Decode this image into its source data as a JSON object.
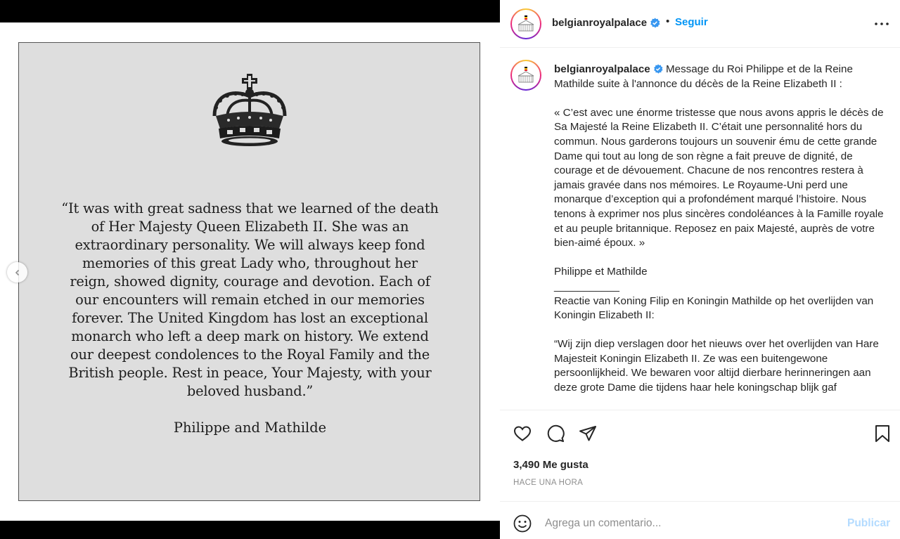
{
  "post": {
    "image": {
      "quote": "“It was with great sadness that we learned of the death of Her Majesty Queen Elizabeth II. She was an extraordinary personality. We will always keep fond memories of this great Lady who, throughout her reign, showed dignity, courage and devotion. Each of our encounters will remain etched in our memories forever. The United Kingdom has lost an exceptional monarch who left a deep mark on history. We extend our deepest condolences to the Royal Family and the British people. Rest in peace, Your Majesty, with your beloved husband.”",
      "signature": "Philippe and Mathilde",
      "background": "#dedede",
      "emblem_icon": "crown-icon"
    },
    "carousel_prev_icon": "chevron-left-icon"
  },
  "header": {
    "username": "belgianroyalpalace",
    "verified": true,
    "separator": "•",
    "follow_label": "Seguir",
    "more_icon": "more-options-icon"
  },
  "caption": {
    "username": "belgianroyalpalace",
    "text": " Message du Roi Philippe et de la Reine Mathilde suite à l'annonce du décès de la Reine Elizabeth II :\n\n« C’est avec une énorme tristesse que nous avons appris le décès de Sa Majesté la Reine Elizabeth II. C’était une personnalité hors du commun. Nous garderons toujours un souvenir ému de cette grande Dame qui tout au long de son règne a fait preuve de dignité, de courage et de dévouement. Chacune de nos rencontres restera à jamais gravée dans nos mémoires. Le Royaume-Uni perd une monarque d’exception qui a profondément marqué l’histoire. Nous tenons à exprimer nos plus sincères condoléances à la Famille royale et au peuple britannique. Reposez en paix Majesté, auprès de votre bien-aimé époux. »\n\nPhilippe et Mathilde\n___________\nReactie van Koning Filip en Koningin Mathilde op het overlijden van Koningin Elizabeth II:\n\n“Wij zijn diep verslagen door het nieuws over het overlijden van Hare Majesteit Koningin Elizabeth II. Ze was een buitengewone persoonlijkheid. We bewaren voor altijd dierbare herinneringen aan deze grote Dame die tijdens haar hele koningschap blijk gaf"
  },
  "actions": {
    "like_icon": "heart-icon",
    "comment_icon": "comment-icon",
    "share_icon": "share-icon",
    "save_icon": "bookmark-icon",
    "likes": "3,490 Me gusta",
    "time": "HACE UNA HORA"
  },
  "comment_box": {
    "placeholder": "Agrega un comentario...",
    "publish_label": "Publicar",
    "emoji_icon": "emoji-icon"
  },
  "colors": {
    "link_blue": "#0095f6",
    "publish_disabled": "#b3dbff",
    "text": "#262626",
    "muted": "#8e8e8e",
    "verified_badge": "#3897f0"
  }
}
